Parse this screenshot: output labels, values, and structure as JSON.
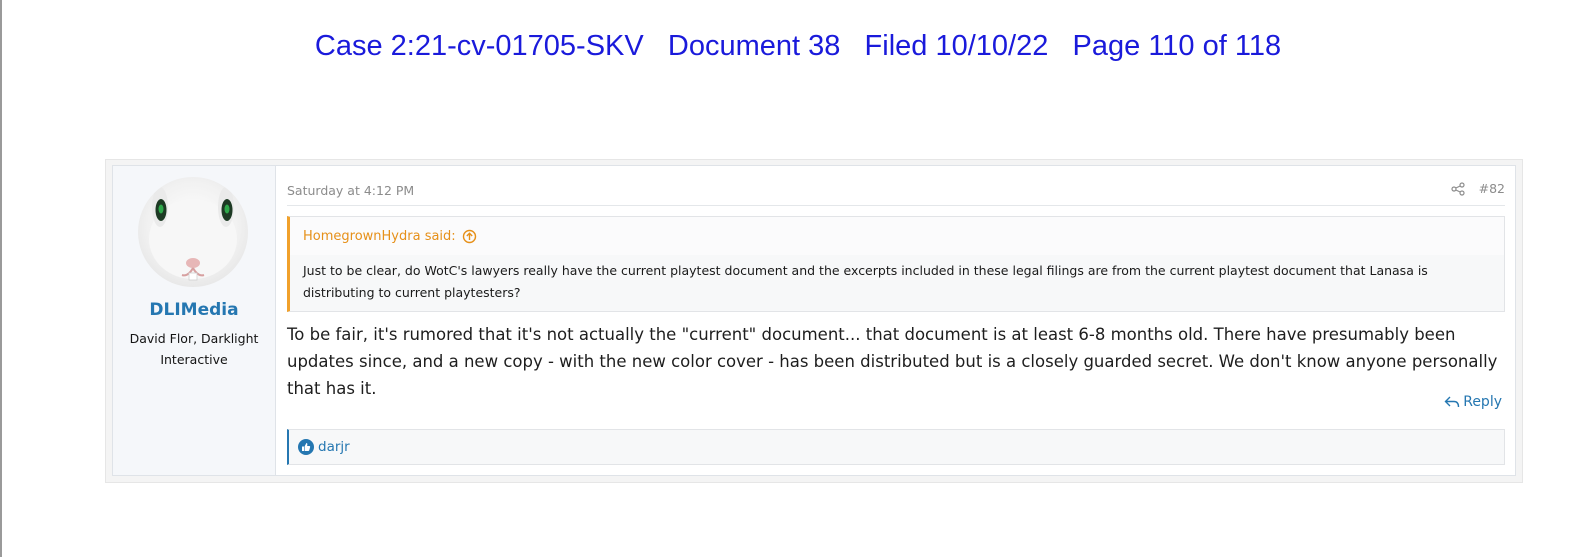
{
  "header": {
    "case_line": "Case 2:21-cv-01705-SKV   Document 38   Filed 10/10/22   Page 110 of 118"
  },
  "post": {
    "user": {
      "name": "DLIMedia",
      "title": "David Flor, Darklight Interactive",
      "avatar_icon": "white-rabbit-avatar"
    },
    "timestamp": "Saturday at 4:12 PM",
    "share_icon": "share-icon",
    "post_number": "#82",
    "quote": {
      "author_line": "HomegrownHydra said:",
      "expand_icon": "circle-arrow-up-icon",
      "text": "Just to be clear, do WotC's lawyers really have the current playtest document and the excerpts included in these legal filings are from the current playtest document that Lanasa is distributing to current playtesters?"
    },
    "message": "To be fair, it's rumored that it's not actually the \"current\" document... that document is at least 6-8 months old. There have presumably been updates since, and a new copy - with the new color cover - has been distributed but is a closely guarded secret. We don't know anyone personally that has it.",
    "reply_label": "Reply",
    "reactions": {
      "icon": "thumbs-up-icon",
      "users": "darjr"
    }
  },
  "colors": {
    "header_text": "#1a1adb",
    "username": "#2577b1",
    "quote_accent": "#f1a12b",
    "link": "#2577b1"
  }
}
